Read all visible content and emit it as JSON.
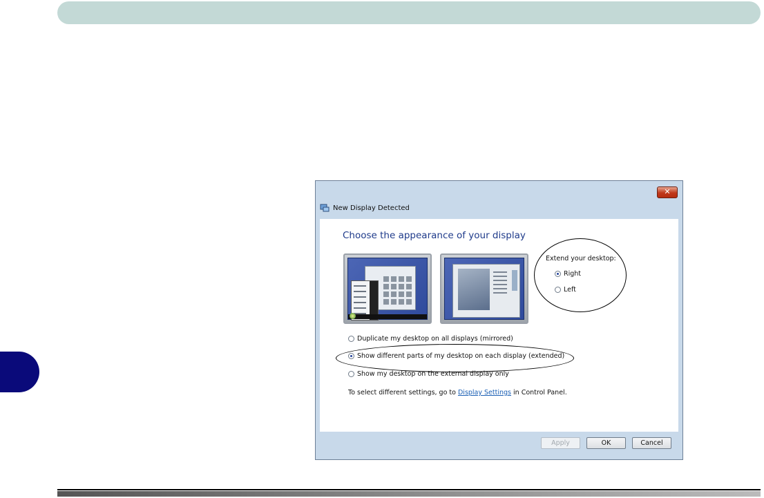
{
  "dialog": {
    "title": "New Display Detected",
    "close_glyph": "✕",
    "heading": "Choose the appearance of your display",
    "extend": {
      "label": "Extend your desktop:",
      "options": [
        {
          "label": "Right",
          "checked": true
        },
        {
          "label": "Left",
          "checked": false
        }
      ]
    },
    "mode_options": [
      {
        "label": "Duplicate my desktop on all displays (mirrored)",
        "checked": false
      },
      {
        "label": "Show different parts of my desktop on each display (extended)",
        "checked": true
      },
      {
        "label": "Show my desktop on the external display only",
        "checked": false
      }
    ],
    "hint": {
      "prefix": "To select different settings, go to ",
      "link": "Display Settings",
      "suffix": " in Control Panel."
    },
    "buttons": {
      "apply": "Apply",
      "ok": "OK",
      "cancel": "Cancel"
    }
  },
  "colors": {
    "header_band": "#c3d9d6",
    "side_tab": "#0a0a7a",
    "dialog_frame": "#c8d9ea",
    "heading_text": "#1e3a8a",
    "link": "#1a5fb4"
  }
}
